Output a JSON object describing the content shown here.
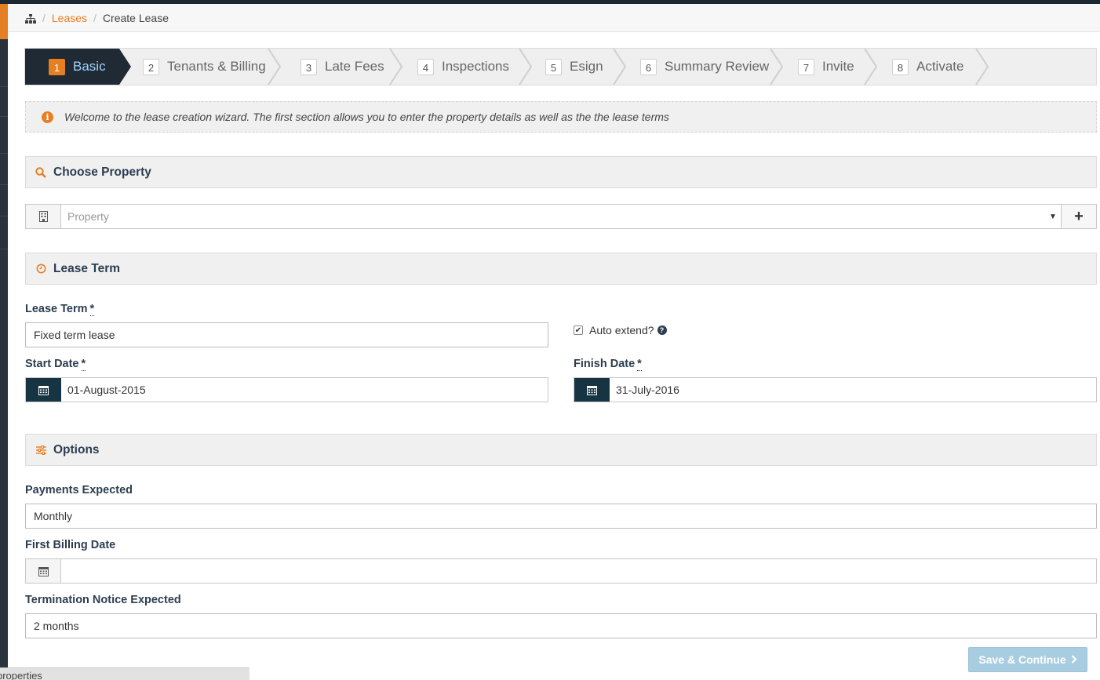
{
  "breadcrumb": {
    "home_icon": "sitemap-icon",
    "items": [
      {
        "label": "Leases"
      },
      {
        "label": "Create Lease"
      }
    ]
  },
  "wizard": {
    "steps": [
      {
        "number": "1",
        "label": "Basic",
        "active": true
      },
      {
        "number": "2",
        "label": "Tenants & Billing",
        "active": false
      },
      {
        "number": "3",
        "label": "Late Fees",
        "active": false
      },
      {
        "number": "4",
        "label": "Inspections",
        "active": false
      },
      {
        "number": "5",
        "label": "Esign",
        "active": false
      },
      {
        "number": "6",
        "label": "Summary Review",
        "active": false
      },
      {
        "number": "7",
        "label": "Invite",
        "active": false
      },
      {
        "number": "8",
        "label": "Activate",
        "active": false
      }
    ]
  },
  "alert": {
    "message": "Welcome to the lease creation wizard. The first section allows you to enter the property details as well as the the lease terms"
  },
  "choose_property": {
    "title": "Choose Property",
    "placeholder": "Property"
  },
  "lease_term": {
    "title": "Lease Term",
    "term_label": "Lease Term",
    "term_value": "Fixed term lease",
    "auto_extend_label": "Auto extend?",
    "auto_extend_checked": true,
    "start_label": "Start Date",
    "start_value": "01-August-2015",
    "finish_label": "Finish Date",
    "finish_value": "31-July-2016",
    "required_mark": "*"
  },
  "options": {
    "title": "Options",
    "payments_label": "Payments Expected",
    "payments_value": "Monthly",
    "billing_label": "First Billing Date",
    "billing_value": "",
    "termination_label": "Termination Notice Expected",
    "termination_value": "2 months"
  },
  "actions": {
    "save_label": "Save & Continue"
  },
  "footer": {
    "tab_text": "properties"
  },
  "colors": {
    "accent": "#e67e22",
    "active_step_bg": "#1f2a35",
    "dark_addon": "#173443",
    "save_button": "#a8cde0"
  }
}
